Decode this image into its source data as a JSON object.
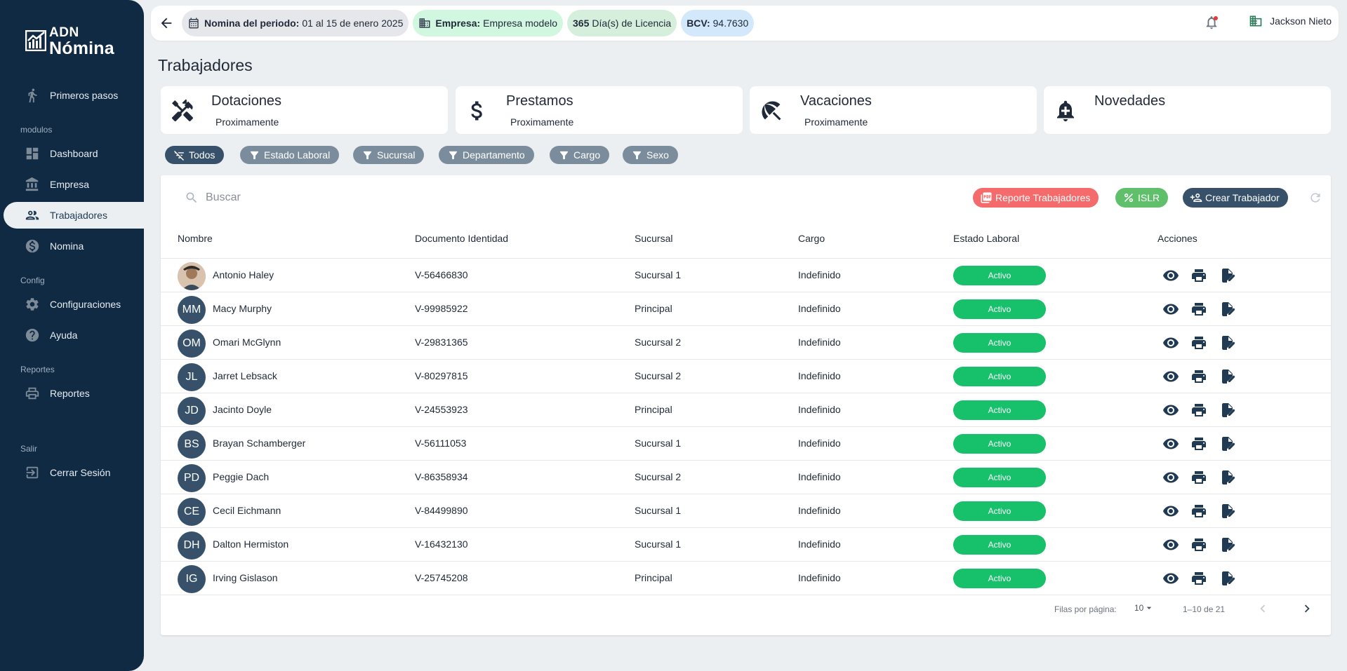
{
  "sidebar": {
    "logo": {
      "line1": "ADN",
      "line2": "Nómina"
    },
    "items": [
      {
        "label": "Primeros pasos",
        "icon": "walk-icon"
      },
      {
        "label": "Dashboard",
        "icon": "dashboard-icon"
      },
      {
        "label": "Empresa",
        "icon": "bank-icon"
      },
      {
        "label": "Trabajadores",
        "icon": "people-icon",
        "active": true
      },
      {
        "label": "Nomina",
        "icon": "money-icon"
      },
      {
        "label": "Configuraciones",
        "icon": "gear-icon"
      },
      {
        "label": "Ayuda",
        "icon": "help-icon"
      },
      {
        "label": "Reportes",
        "icon": "print-icon"
      },
      {
        "label": "Cerrar Sesión",
        "icon": "logout-icon"
      }
    ],
    "sections": {
      "modulos": "modulos",
      "config": "Config",
      "reportes": "Reportes",
      "salir": "Salir"
    }
  },
  "topbar": {
    "period_label": "Nomina del periodo:",
    "period_value": "01 al 15 de enero 2025",
    "company_label": "Empresa:",
    "company_value": "Empresa modelo",
    "license_value": "365",
    "license_label": "Día(s) de Licencia",
    "bcv_label": "BCV:",
    "bcv_value": "94.7630",
    "user_name": "Jackson Nieto"
  },
  "page_title": "Trabajadores",
  "cards": [
    {
      "title": "Dotaciones",
      "subtitle": "Proximamente"
    },
    {
      "title": "Prestamos",
      "subtitle": "Proximamente"
    },
    {
      "title": "Vacaciones",
      "subtitle": "Proximamente"
    },
    {
      "title": "Novedades",
      "subtitle": ""
    }
  ],
  "filters": [
    "Todos",
    "Estado Laboral",
    "Sucursal",
    "Departamento",
    "Cargo",
    "Sexo"
  ],
  "search_placeholder": "Buscar",
  "buttons": {
    "report": "Reporte Trabajadores",
    "islr": "ISLR",
    "create": "Crear Trabajador"
  },
  "table": {
    "headers": [
      "Nombre",
      "Documento Identidad",
      "Sucursal",
      "Cargo",
      "Estado Laboral",
      "Acciones"
    ],
    "rows": [
      {
        "initials": "",
        "name": "Antonio Haley",
        "doc": "V-56466830",
        "branch": "Sucursal 1",
        "cargo": "Indefinido",
        "status": "Activo"
      },
      {
        "initials": "MM",
        "name": "Macy Murphy",
        "doc": "V-99985922",
        "branch": "Principal",
        "cargo": "Indefinido",
        "status": "Activo"
      },
      {
        "initials": "OM",
        "name": "Omari McGlynn",
        "doc": "V-29831365",
        "branch": "Sucursal 2",
        "cargo": "Indefinido",
        "status": "Activo"
      },
      {
        "initials": "JL",
        "name": "Jarret Lebsack",
        "doc": "V-80297815",
        "branch": "Sucursal 2",
        "cargo": "Indefinido",
        "status": "Activo"
      },
      {
        "initials": "JD",
        "name": "Jacinto Doyle",
        "doc": "V-24553923",
        "branch": "Principal",
        "cargo": "Indefinido",
        "status": "Activo"
      },
      {
        "initials": "BS",
        "name": "Brayan Schamberger",
        "doc": "V-56111053",
        "branch": "Sucursal 1",
        "cargo": "Indefinido",
        "status": "Activo"
      },
      {
        "initials": "PD",
        "name": "Peggie Dach",
        "doc": "V-86358934",
        "branch": "Sucursal 2",
        "cargo": "Indefinido",
        "status": "Activo"
      },
      {
        "initials": "CE",
        "name": "Cecil Eichmann",
        "doc": "V-84499890",
        "branch": "Sucursal 1",
        "cargo": "Indefinido",
        "status": "Activo"
      },
      {
        "initials": "DH",
        "name": "Dalton Hermiston",
        "doc": "V-16432130",
        "branch": "Sucursal 1",
        "cargo": "Indefinido",
        "status": "Activo"
      },
      {
        "initials": "IG",
        "name": "Irving Gislason",
        "doc": "V-25745208",
        "branch": "Principal",
        "cargo": "Indefinido",
        "status": "Activo"
      }
    ]
  },
  "pagination": {
    "rows_label": "Filas por página:",
    "rows_value": "10",
    "range": "1–10 de 21"
  },
  "colors": {
    "sidebar": "#102a43",
    "active_badge": "#17c06b",
    "filter_active": "#37516b",
    "filter": "#7b8d9d"
  }
}
